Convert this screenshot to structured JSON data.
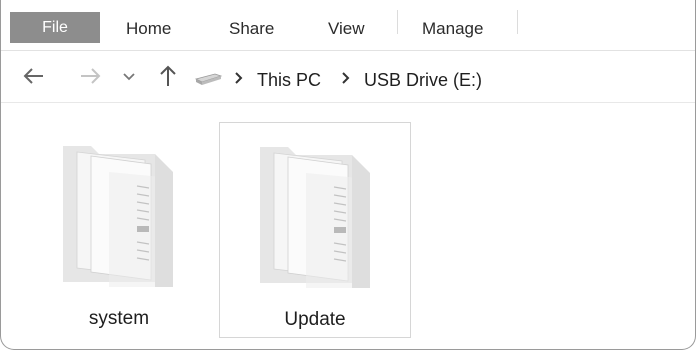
{
  "ribbon": {
    "tabs": [
      {
        "label": "File",
        "active": true
      },
      {
        "label": "Home"
      },
      {
        "label": "Share"
      },
      {
        "label": "View"
      },
      {
        "label": "Manage"
      }
    ]
  },
  "nav": {
    "back_icon": "arrow-left-icon",
    "forward_icon": "arrow-right-icon",
    "recent_icon": "chevron-down-icon",
    "up_icon": "arrow-up-icon",
    "location_icon": "usb-drive-icon",
    "breadcrumb": [
      "This PC",
      "USB Drive (E:)"
    ]
  },
  "content": {
    "items": [
      {
        "label": "system",
        "icon": "folder-icon"
      },
      {
        "label": "Update",
        "icon": "folder-icon",
        "selected": true
      }
    ]
  },
  "colors": {
    "file_tab_bg": "#8d8d8d",
    "selection_border": "#d6d6d6"
  }
}
